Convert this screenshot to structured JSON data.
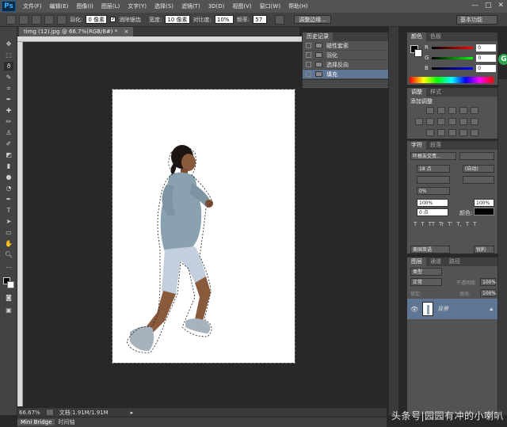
{
  "app": {
    "logo": "Ps"
  },
  "menu": [
    "文件(F)",
    "编辑(E)",
    "图像(I)",
    "图层(L)",
    "文字(Y)",
    "选择(S)",
    "滤镜(T)",
    "3D(D)",
    "视图(V)",
    "窗口(W)",
    "帮助(H)"
  ],
  "window_controls": {
    "minimize": "—",
    "maximize": "□",
    "close": "✕"
  },
  "options": {
    "feather_label": "羽化:",
    "feather_value": "0 像素",
    "antialias_label": "消除锯齿",
    "width_label": "宽度:",
    "width_value": "10 像素",
    "contrast_label": "对比度:",
    "contrast_value": "10%",
    "frequency_label": "频率:",
    "frequency_value": "57",
    "refine_edge": "调整边缘...",
    "workspace": "基本功能"
  },
  "document": {
    "tab_title": "timg (12).jpg @ 66.7%(RGB/8#) *",
    "tab_close": "×"
  },
  "status": {
    "zoom": "66.67%",
    "doc_size": "文档:1.91M/1.91M"
  },
  "bottom_tabs": [
    "Mini Bridge",
    "时间轴"
  ],
  "history": {
    "tab": "历史记录",
    "items": [
      {
        "label": "磁性套索",
        "selected": false
      },
      {
        "label": "羽化",
        "selected": false
      },
      {
        "label": "选择反向",
        "selected": false
      },
      {
        "label": "填充",
        "selected": true
      }
    ]
  },
  "color_panel": {
    "tabs": [
      "颜色",
      "色板"
    ],
    "channels": [
      {
        "name": "R",
        "value": "0"
      },
      {
        "name": "G",
        "value": "0"
      },
      {
        "name": "B",
        "value": "0"
      }
    ]
  },
  "adjustments": {
    "tabs": [
      "调整",
      "样式"
    ],
    "add_label": "添加调整"
  },
  "character": {
    "tabs": [
      "字符",
      "段落"
    ],
    "font": "叶根友交责...",
    "size": "18 点",
    "leading": "(自动)",
    "tracking": "0%",
    "scale_v": "100%",
    "scale_h": "100%",
    "baseline": "0 点",
    "color_label": "颜色:",
    "language": "美国英语",
    "antialias": "锐利",
    "text_styles": [
      "T",
      "T",
      "TT",
      "Tr",
      "T'",
      "T,",
      "T",
      "T"
    ]
  },
  "layers": {
    "tabs": [
      "图层",
      "通道",
      "路径"
    ],
    "kind": "类型",
    "blend": "正常",
    "opacity_label": "不透明度:",
    "opacity": "100%",
    "lock_label": "锁定:",
    "fill_label": "填充:",
    "fill": "100%",
    "layer_name": "背景"
  },
  "watermark": "头条号|园园有冲的小喇叭",
  "colors": {
    "accent_selected": "#5f7594",
    "panel_bg": "#535353",
    "canvas_bg": "#282828"
  }
}
